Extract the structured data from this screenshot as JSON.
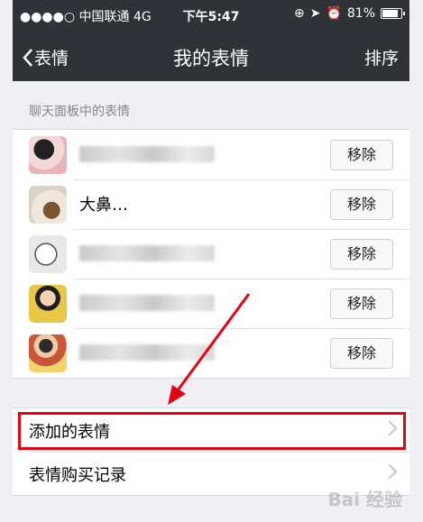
{
  "status_bar": {
    "carrier": "●●●●○ 中国联通 4G",
    "time": "下午5:47",
    "battery": "81%",
    "battery_level": 0.81
  },
  "nav": {
    "back_label": "表情",
    "title": "我的表情",
    "sort_label": "排序"
  },
  "section_label": "聊天面板中的表情",
  "stickers": [
    {
      "name": "",
      "remove_label": "移除",
      "avatar_color": "#e9b3b8"
    },
    {
      "name": "大鼻…",
      "remove_label": "移除",
      "avatar_color": "#b9a28a"
    },
    {
      "name": "",
      "remove_label": "移除",
      "avatar_color": "#d7d7d7"
    },
    {
      "name": "",
      "remove_label": "移除",
      "avatar_color": "#e8c646"
    },
    {
      "name": "",
      "remove_label": "移除",
      "avatar_color": "#c7563d"
    }
  ],
  "menu": {
    "added_label": "添加的表情",
    "purchase_label": "表情购买记录"
  },
  "annotation": {
    "highlight_color": "#e60012"
  },
  "watermark": "Bai 经验"
}
